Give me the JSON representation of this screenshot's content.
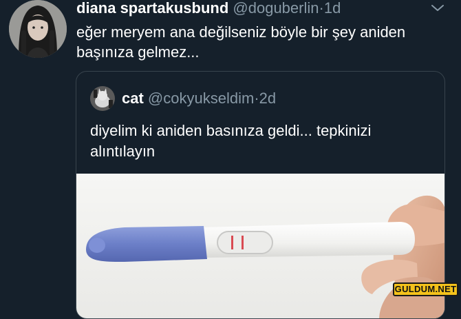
{
  "tweet": {
    "display_name": "diana spartakusbund",
    "handle": "@doguberlin",
    "separator": "·",
    "time": "1d",
    "text": "eğer meryem ana değilseniz böyle bir şey aniden başınıza gelmez...",
    "menu_icon": "chevron-down-icon"
  },
  "quoted_tweet": {
    "display_name": "cat",
    "handle": "@cokyukseldim",
    "separator": "·",
    "time": "2d",
    "text": "diyelim ki aniden basınıza geldi... tepkinizi alıntılayın",
    "image": "pregnancy-test-photo"
  },
  "watermark": {
    "text": "GULDUM.NET",
    "color": "#f4c21b"
  },
  "colors": {
    "background": "#15202b",
    "text_primary": "#ffffff",
    "text_secondary": "#8899a6",
    "border": "#38444d"
  }
}
